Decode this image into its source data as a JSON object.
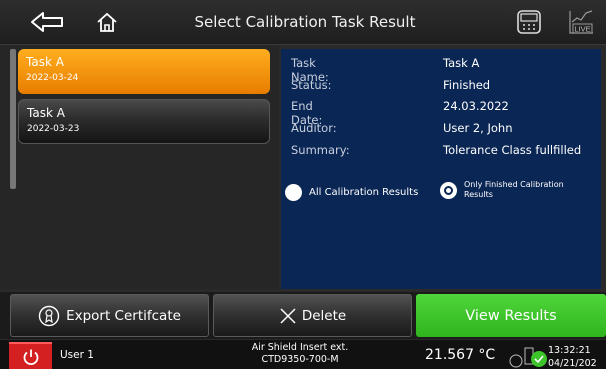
{
  "header": {
    "title": "Select Calibration Task Result",
    "back_icon": "back-arrow-icon",
    "home_icon": "home-icon",
    "device_icon": "device-icon",
    "live_label": "LIVE"
  },
  "tasks": [
    {
      "name": "Task A",
      "date": "2022-03-24",
      "selected": true
    },
    {
      "name": "Task A",
      "date": "2022-03-23",
      "selected": false
    }
  ],
  "details": {
    "rows": [
      {
        "label": "Task Name:",
        "value": "Task A"
      },
      {
        "label": "Status:",
        "value": "Finished"
      },
      {
        "label": "End Date:",
        "value": "24.03.2022"
      },
      {
        "label": "Auditor:",
        "value": "User 2, John"
      },
      {
        "label": "Summary:",
        "value": "Tolerance Class fullfilled"
      }
    ],
    "radio_options": [
      {
        "label": "All Calibration Results",
        "selected": false
      },
      {
        "label": "Only Finished Calibration Results",
        "selected": true
      }
    ]
  },
  "actions": {
    "export_label": "Export Certifcate",
    "delete_label": "Delete",
    "view_label": "View Results"
  },
  "status": {
    "user": "User 1",
    "device_line1": "Air Shield Insert ext.",
    "device_line2": "CTD9350-700-M",
    "temperature": "21.567 °C",
    "time": "13:32:21",
    "date": "04/21/202"
  },
  "colors": {
    "accent_orange": "#f59a10",
    "detail_bg": "#0a2654",
    "view_green": "#3cc42a",
    "power_red": "#d42020"
  }
}
